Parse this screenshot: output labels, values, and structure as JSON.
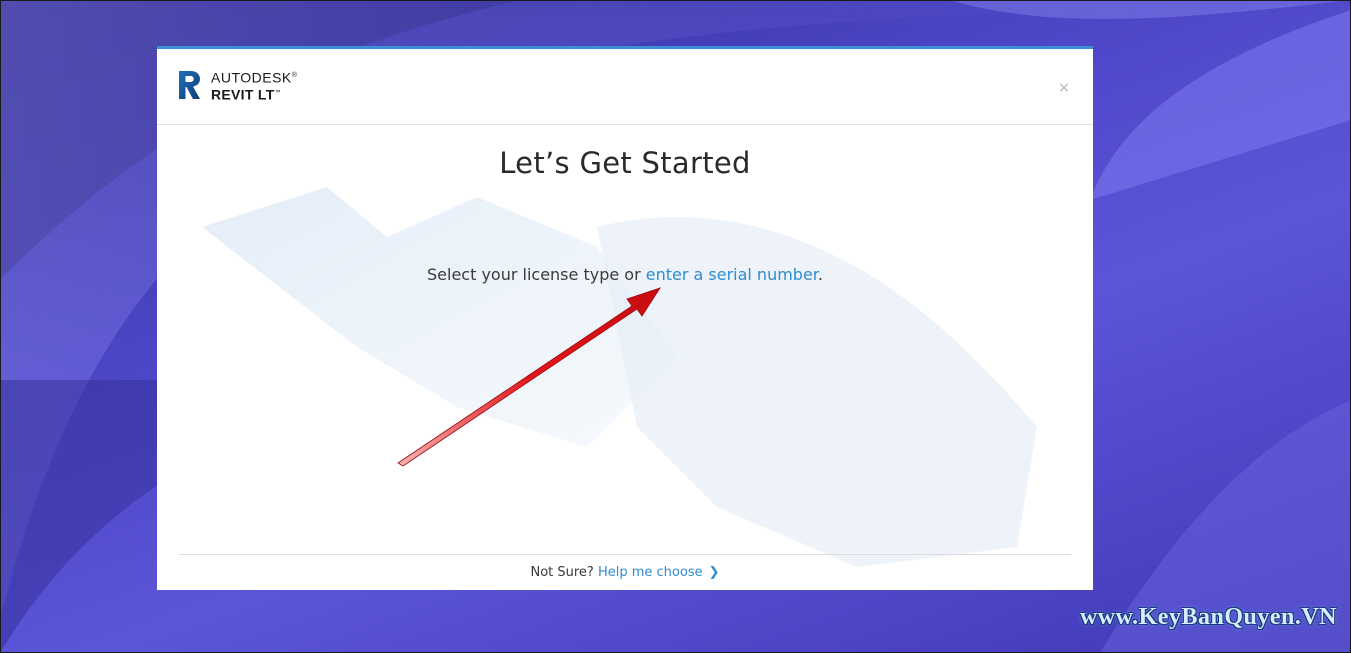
{
  "app": {
    "brand": "AUTODESK",
    "product": "REVIT LT",
    "brand_mark": "®",
    "product_mark": "™"
  },
  "dialog": {
    "close_symbol": "×",
    "title": "Let’s Get Started",
    "prompt_text": "Select your license type or ",
    "serial_link": "enter a serial number",
    "prompt_end": ".",
    "footer_text": "Not Sure? ",
    "help_link": "Help me choose",
    "chevron": "❯"
  },
  "watermark": {
    "text": "www.KeyBanQuyen.VN"
  },
  "icons": {
    "logo": "revit-r-logo-icon",
    "close": "close-icon",
    "chevron": "chevron-right-icon",
    "arrow": "red-arrow-annotation"
  },
  "colors": {
    "accent": "#3b8fd6",
    "link": "#2f8ccf",
    "arrow": "#e3171b"
  }
}
